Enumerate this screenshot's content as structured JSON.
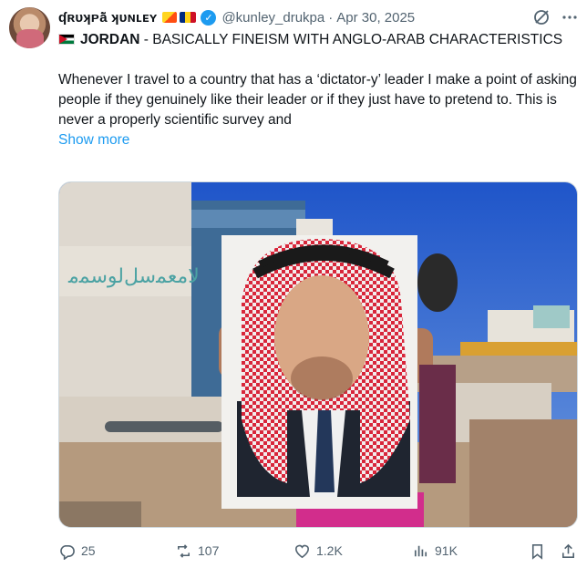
{
  "author": {
    "display_name": "ʠʀᴜʞᴘā̃ ʞᴜɴʟᴇʏ",
    "handle": "@kunley_drukpa",
    "date": "Apr 30, 2025",
    "separator": "·",
    "verified_mark": "✓"
  },
  "post": {
    "title_bold": "JORDAN",
    "title_rest": " - BASICALLY FINEISM WITH ANGLO-ARAB CHARACTERISTICS",
    "body": "Whenever I travel to a country that has a ‘dictator-y’ leader I make a point of asking people if they genuinely like their leader or if they just have to pretend to. This is never a properly scientific survey and",
    "show_more": "Show more"
  },
  "media": {
    "wall_script": "ﻟﺎﻣﻌﻤﺳﻞﻟﻮﺳﻤﻣ"
  },
  "actions": {
    "replies": "25",
    "reposts": "107",
    "likes": "1.2K",
    "views": "91K"
  },
  "icons": {
    "grok": "grok-icon",
    "more": "more-options-icon",
    "reply": "reply-icon",
    "repost": "repost-icon",
    "like": "heart-icon",
    "views": "analytics-icon",
    "bookmark": "bookmark-icon",
    "share": "share-icon"
  },
  "colors": {
    "accent": "#1d9bf0",
    "muted": "#536471",
    "text": "#0f1419"
  }
}
